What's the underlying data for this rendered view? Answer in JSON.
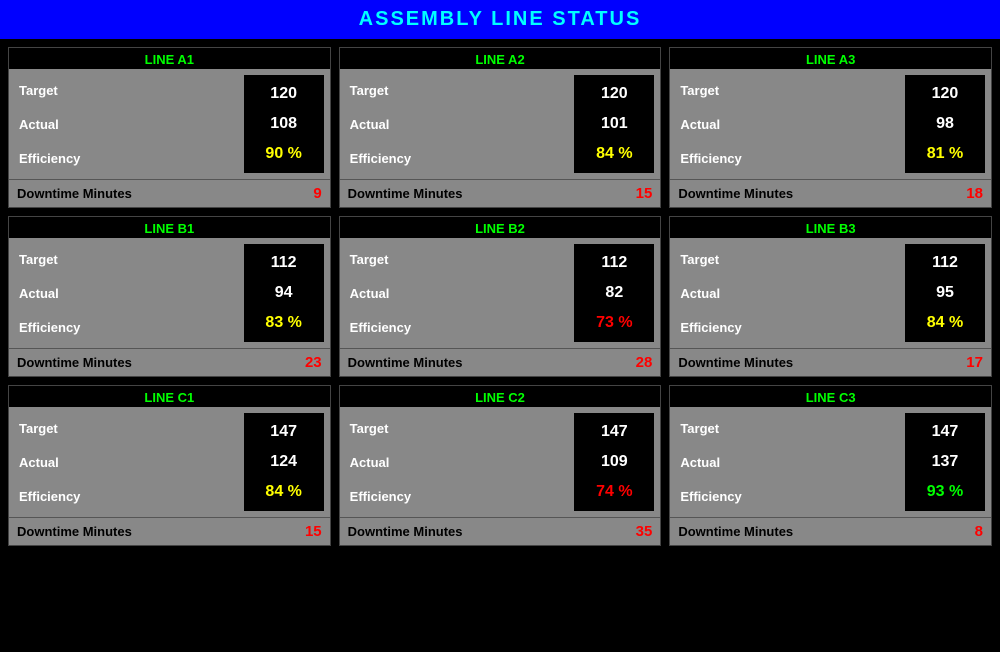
{
  "header": {
    "title": "ASSEMBLY LINE STATUS"
  },
  "cards": [
    {
      "id": "line-a1",
      "title": "LINE A1",
      "target": "120",
      "actual": "108",
      "efficiency": "90 %",
      "efficiency_color": "yellow",
      "downtime_label": "Downtime Minutes",
      "downtime_value": "9"
    },
    {
      "id": "line-a2",
      "title": "LINE A2",
      "target": "120",
      "actual": "101",
      "efficiency": "84 %",
      "efficiency_color": "yellow",
      "downtime_label": "Downtime Minutes",
      "downtime_value": "15"
    },
    {
      "id": "line-a3",
      "title": "LINE A3",
      "target": "120",
      "actual": "98",
      "efficiency": "81 %",
      "efficiency_color": "yellow",
      "downtime_label": "Downtime Minutes",
      "downtime_value": "18"
    },
    {
      "id": "line-b1",
      "title": "LINE B1",
      "target": "112",
      "actual": "94",
      "efficiency": "83 %",
      "efficiency_color": "yellow",
      "downtime_label": "Downtime Minutes",
      "downtime_value": "23"
    },
    {
      "id": "line-b2",
      "title": "LINE B2",
      "target": "112",
      "actual": "82",
      "efficiency": "73 %",
      "efficiency_color": "red",
      "downtime_label": "Downtime Minutes",
      "downtime_value": "28"
    },
    {
      "id": "line-b3",
      "title": "LINE B3",
      "target": "112",
      "actual": "95",
      "efficiency": "84 %",
      "efficiency_color": "yellow",
      "downtime_label": "Downtime Minutes",
      "downtime_value": "17"
    },
    {
      "id": "line-c1",
      "title": "LINE C1",
      "target": "147",
      "actual": "124",
      "efficiency": "84 %",
      "efficiency_color": "yellow",
      "downtime_label": "Downtime Minutes",
      "downtime_value": "15"
    },
    {
      "id": "line-c2",
      "title": "LINE C2",
      "target": "147",
      "actual": "109",
      "efficiency": "74 %",
      "efficiency_color": "red",
      "downtime_label": "Downtime Minutes",
      "downtime_value": "35"
    },
    {
      "id": "line-c3",
      "title": "LINE C3",
      "target": "147",
      "actual": "137",
      "efficiency": "93 %",
      "efficiency_color": "green",
      "downtime_label": "Downtime Minutes",
      "downtime_value": "8"
    }
  ],
  "labels": {
    "target": "Target",
    "actual": "Actual",
    "efficiency": "Efficiency"
  }
}
